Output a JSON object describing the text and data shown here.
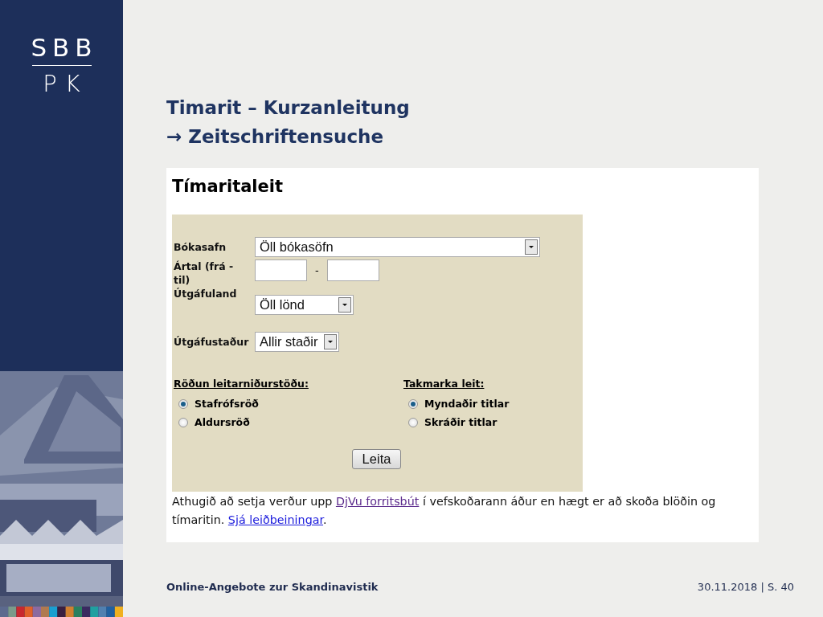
{
  "logo": {
    "top": "SBB",
    "bottom": "PK"
  },
  "title": {
    "line_1": "Timarit – Kurzanleitung",
    "line_2": "→ Zeitschriftensuche"
  },
  "screenshot": {
    "heading": "Tímaritaleit",
    "fields": [
      {
        "kind": "select",
        "label": "Bókasafn",
        "value": "Öll bókasöfn"
      },
      {
        "kind": "range",
        "label": "Ártal (frá - til)",
        "separator": "-"
      },
      {
        "kind": "select",
        "label": "Útgáfuland",
        "value": "Öll lönd"
      },
      {
        "kind": "select",
        "label": "Útgáfustaður",
        "value": "Allir staðir"
      }
    ],
    "radio_groups": [
      {
        "heading": "Röðun leitarniðurstöðu:",
        "options": [
          {
            "label": "Stafrófsröð",
            "selected": true
          },
          {
            "label": "Aldursröð",
            "selected": false
          }
        ]
      },
      {
        "heading": "Takmarka leit:",
        "options": [
          {
            "label": "Myndaðir titlar",
            "selected": true
          },
          {
            "label": "Skráðir titlar",
            "selected": false
          }
        ]
      }
    ],
    "button": "Leita",
    "note": [
      {
        "kind": "text",
        "text": "Athugið að setja verður upp "
      },
      {
        "kind": "link",
        "text": "DjVu forritsbút",
        "visited": true
      },
      {
        "kind": "text",
        "text": " í vefskoðarann áður en hægt er að skoða blöðin og tímaritin. "
      },
      {
        "kind": "link",
        "text": "Sjá leiðbeiningar",
        "visited": false
      },
      {
        "kind": "text",
        "text": "."
      }
    ]
  },
  "footer": {
    "left": "Online-Angebote zur Skandinavistik",
    "right": "30.11.2018 | S. 40"
  }
}
